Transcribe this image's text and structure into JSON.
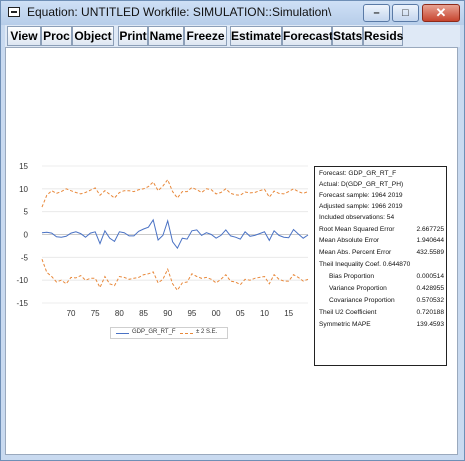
{
  "window": {
    "title": "Equation: UNTITLED   Workfile: SIMULATION::Simulation\\",
    "min_glyph": "–",
    "max_glyph": "□",
    "close_glyph": "✕"
  },
  "toolbar": {
    "buttons": [
      "View",
      "Proc",
      "Object",
      "Print",
      "Name",
      "Freeze",
      "Estimate",
      "Forecast",
      "Stats",
      "Resids"
    ]
  },
  "chart_data": {
    "type": "line",
    "x": [
      1964,
      1965,
      1966,
      1967,
      1968,
      1969,
      1970,
      1971,
      1972,
      1973,
      1974,
      1975,
      1976,
      1977,
      1978,
      1979,
      1980,
      1981,
      1982,
      1983,
      1984,
      1985,
      1986,
      1987,
      1988,
      1989,
      1990,
      1991,
      1992,
      1993,
      1994,
      1995,
      1996,
      1997,
      1998,
      1999,
      2000,
      2001,
      2002,
      2003,
      2004,
      2005,
      2006,
      2007,
      2008,
      2009,
      2010,
      2011,
      2012,
      2013,
      2014,
      2015,
      2016,
      2017,
      2018,
      2019
    ],
    "series": [
      {
        "name": "GDP_GR_RT_F",
        "style": "solid",
        "color": "#4a72c4",
        "values": [
          0.4,
          0.5,
          0.3,
          -0.5,
          -0.6,
          -0.4,
          0.3,
          0.6,
          0.2,
          -0.6,
          0.3,
          0.6,
          -2.0,
          0.8,
          -0.8,
          -1.5,
          0.6,
          0.4,
          -0.3,
          -0.3,
          0.7,
          1.2,
          1.6,
          3.2,
          -1.2,
          -0.2,
          3.0,
          -1.6,
          -3.0,
          -0.8,
          -1.0,
          0.8,
          1.0,
          -0.2,
          0.4,
          0.0,
          -0.8,
          -0.2,
          1.0,
          -0.3,
          -0.6,
          -1.0,
          0.6,
          -0.4,
          -0.2,
          0.2,
          0.6,
          -1.3,
          0.8,
          -0.2,
          -0.6,
          -0.7,
          1.1,
          0.1,
          -0.8,
          -0.1,
          -0.5
        ]
      },
      {
        "name": "± 2 S.E.",
        "style": "dashed",
        "color": "#e8883a",
        "upper": [
          6.0,
          8.6,
          9.6,
          9.0,
          9.4,
          10.0,
          9.6,
          9.2,
          8.9,
          9.2,
          9.7,
          10.2,
          8.6,
          9.6,
          8.8,
          8.0,
          9.2,
          9.6,
          9.6,
          9.4,
          9.8,
          10.0,
          10.5,
          11.5,
          9.6,
          10.6,
          12.0,
          9.4,
          8.0,
          9.4,
          9.4,
          10.3,
          9.8,
          9.2,
          10.0,
          9.8,
          8.9,
          9.2,
          10.0,
          9.0,
          8.7,
          8.6,
          9.3,
          9.1,
          9.2,
          9.6,
          9.9,
          8.2,
          9.5,
          9.0,
          8.9,
          9.4,
          10.0,
          9.4,
          9.0,
          9.4,
          9.1
        ],
        "lower": [
          -5.4,
          -8.3,
          -9.2,
          -10.4,
          -10.0,
          -10.8,
          -9.4,
          -9.5,
          -9.0,
          -10.0,
          -9.6,
          -9.6,
          -11.6,
          -9.2,
          -10.8,
          -11.2,
          -9.2,
          -9.4,
          -9.8,
          -9.6,
          -9.4,
          -8.8,
          -8.6,
          -8.2,
          -10.6,
          -9.8,
          -7.6,
          -10.8,
          -12.2,
          -10.6,
          -10.4,
          -8.6,
          -9.2,
          -9.6,
          -9.4,
          -9.8,
          -10.6,
          -9.8,
          -8.8,
          -10.2,
          -10.4,
          -11.0,
          -9.8,
          -10.0,
          -9.6,
          -9.4,
          -9.2,
          -10.8,
          -8.8,
          -9.8,
          -10.2,
          -10.2,
          -8.8,
          -9.4,
          -10.2,
          -9.8,
          -9.6
        ]
      }
    ],
    "yticks": [
      15,
      10,
      5,
      0,
      -5,
      -10,
      -15
    ],
    "xticks": [
      "70",
      "75",
      "80",
      "85",
      "90",
      "95",
      "00",
      "05",
      "10",
      "15"
    ],
    "xtick_years": [
      1970,
      1975,
      1980,
      1985,
      1990,
      1995,
      2000,
      2005,
      2010,
      2015
    ],
    "ylim": [
      -15,
      15
    ],
    "xlim": [
      1964,
      2019
    ],
    "grid": true,
    "legend_placement": "bottom",
    "legend": [
      "GDP_GR_RT_F",
      "± 2 S.E."
    ]
  },
  "stats": {
    "header": [
      "Forecast: GDP_GR_RT_F",
      "Actual: D(GDP_GR_RT_PH)",
      "Forecast sample: 1964 2019",
      "Adjusted sample: 1966 2019",
      "Included observations: 54"
    ],
    "rows": [
      {
        "label": "Root Mean Squared Error",
        "value": "2.667725",
        "indent": false
      },
      {
        "label": "Mean Absolute Error",
        "value": "1.940644",
        "indent": false
      },
      {
        "label": "Mean Abs. Percent Error",
        "value": "432.5589",
        "indent": false
      },
      {
        "label": "Theil Inequality Coef.  0.644870",
        "value": "",
        "indent": false
      },
      {
        "label": "Bias Proportion",
        "value": "0.000514",
        "indent": true
      },
      {
        "label": "Variance Proportion",
        "value": "0.428955",
        "indent": true
      },
      {
        "label": "Covariance Proportion",
        "value": "0.570532",
        "indent": true
      },
      {
        "label": "Theil U2 Coefficient",
        "value": "0.720188",
        "indent": false
      },
      {
        "label": "Symmetric MAPE",
        "value": "139.4593",
        "indent": false
      }
    ]
  }
}
